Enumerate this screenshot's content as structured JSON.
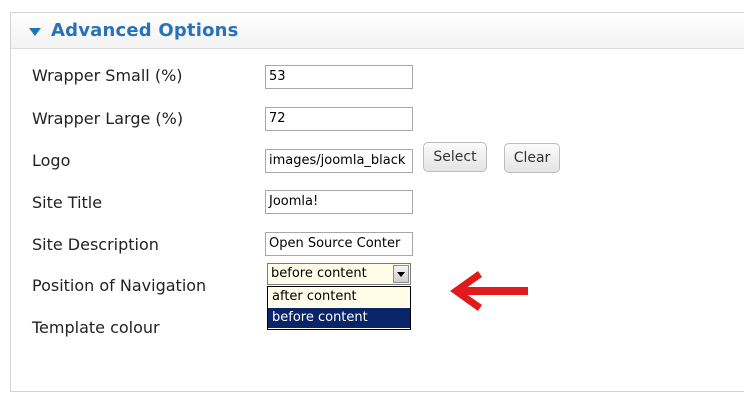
{
  "panel": {
    "title": "Advanced Options"
  },
  "fields": {
    "wrapper_small": {
      "label": "Wrapper Small (%)",
      "value": "53"
    },
    "wrapper_large": {
      "label": "Wrapper Large (%)",
      "value": "72"
    },
    "logo": {
      "label": "Logo",
      "value": "images/joomla_black"
    },
    "site_title": {
      "label": "Site Title",
      "value": "Joomla!"
    },
    "site_description": {
      "label": "Site Description",
      "value": "Open Source Conter"
    },
    "nav_position": {
      "label": "Position of Navigation",
      "selected": "before content",
      "options": [
        "after content",
        "before content"
      ]
    },
    "template_colour": {
      "label": "Template colour"
    }
  },
  "buttons": {
    "select": "Select",
    "clear": "Clear"
  },
  "colors": {
    "header_text": "#2872b7",
    "dropdown_highlight": "#0a246a",
    "annotation_arrow": "#e01b1b"
  },
  "icons": {
    "collapse": "triangle-down-icon",
    "annotation": "red-left-arrow-icon"
  }
}
